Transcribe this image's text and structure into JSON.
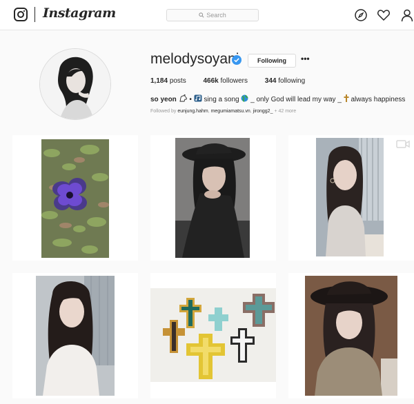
{
  "app": {
    "name": "Instagram"
  },
  "header": {
    "logo_text": "Instagram",
    "search": {
      "placeholder": "Search"
    },
    "icons": [
      "compass-icon",
      "heart-icon",
      "person-icon"
    ]
  },
  "profile": {
    "username": "melodysoyani",
    "verified": true,
    "follow_button": "Following",
    "more_button": "•••",
    "stats": {
      "posts_value": "1,184",
      "posts_label": "posts",
      "followers_value": "466k",
      "followers_label": "followers",
      "following_value": "344",
      "following_label": "following"
    },
    "bio": {
      "name": "so yeon",
      "separator": "•",
      "part1": "sing a song",
      "part2": "_ only God will lead my way _",
      "part3": "always happiness"
    },
    "followed_by": {
      "prefix": "Followed by",
      "users": [
        "eunjung.hahm",
        "megumiamatsu.vn",
        "jirongg2_"
      ],
      "suffix": "+ 42 more"
    }
  },
  "posts": [
    {
      "id": "post-1",
      "subject": "purple flower",
      "is_video": false
    },
    {
      "id": "post-2",
      "subject": "woman in black hat",
      "is_video": false
    },
    {
      "id": "post-3",
      "subject": "selfie",
      "is_video": true
    },
    {
      "id": "post-4",
      "subject": "selfie",
      "is_video": false
    },
    {
      "id": "post-5",
      "subject": "decorative crosses",
      "is_video": false
    },
    {
      "id": "post-6",
      "subject": "woman in hat",
      "is_video": false
    }
  ],
  "colors": {
    "accent": "#3897f0",
    "border": "#dbdbdb",
    "text": "#262626",
    "muted": "#999999",
    "background": "#fafafa"
  }
}
